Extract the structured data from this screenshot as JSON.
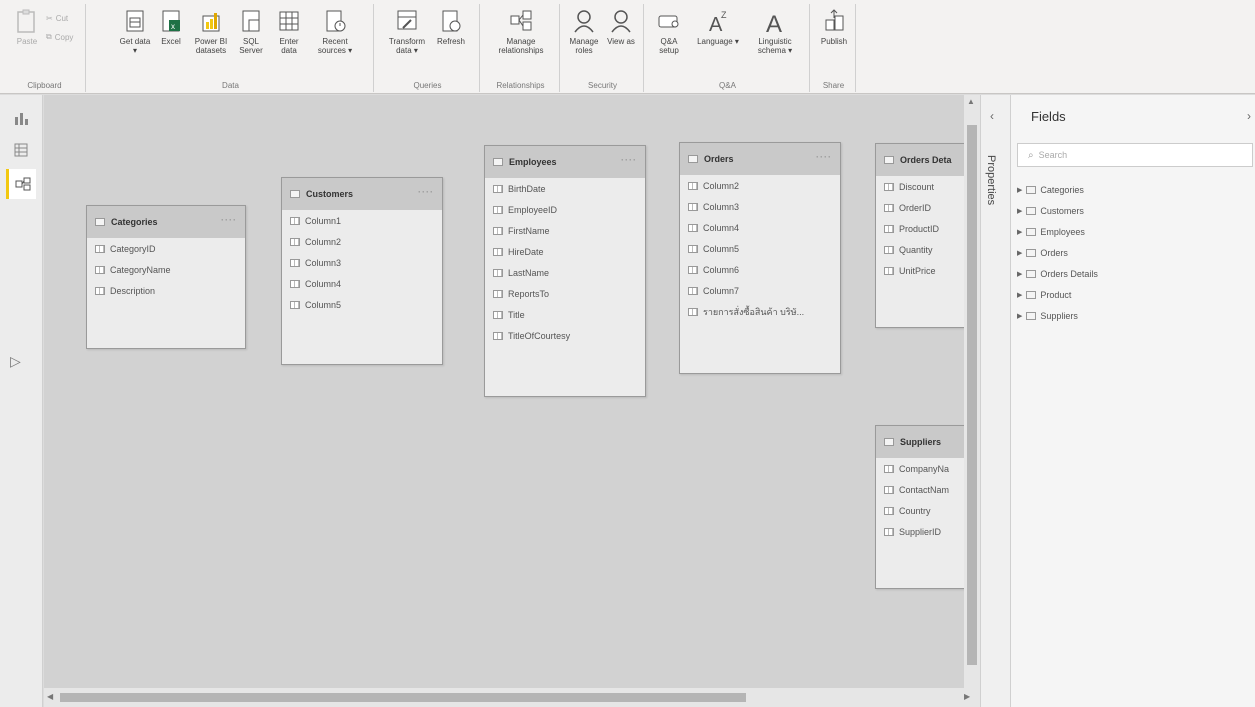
{
  "ribbon": {
    "clipboard": {
      "paste": "Paste",
      "cut": "Cut",
      "copy": "Copy",
      "label": "Clipboard"
    },
    "data": {
      "label": "Data",
      "buttons": [
        "Get data ▾",
        "Excel",
        "Power BI datasets",
        "SQL Server",
        "Enter data",
        "Recent sources ▾"
      ]
    },
    "queries": {
      "label": "Queries",
      "buttons": [
        "Transform data ▾",
        "Refresh"
      ]
    },
    "relationships": {
      "label": "Relationships",
      "buttons": [
        "Manage relationships"
      ]
    },
    "security": {
      "label": "Security",
      "buttons": [
        "Manage roles",
        "View as"
      ]
    },
    "qa": {
      "label": "Q&A",
      "buttons": [
        "Q&A setup",
        "Language ▾",
        "Linguistic schema ▾"
      ]
    },
    "share": {
      "label": "Share",
      "buttons": [
        "Publish"
      ]
    }
  },
  "tables": [
    {
      "name": "Categories",
      "fields": [
        "CategoryID",
        "CategoryName",
        "Description"
      ]
    },
    {
      "name": "Customers",
      "fields": [
        "Column1",
        "Column2",
        "Column3",
        "Column4",
        "Column5"
      ]
    },
    {
      "name": "Employees",
      "fields": [
        "BirthDate",
        "EmployeeID",
        "FirstName",
        "HireDate",
        "LastName",
        "ReportsTo",
        "Title",
        "TitleOfCourtesy"
      ]
    },
    {
      "name": "Orders",
      "fields": [
        "Column2",
        "Column3",
        "Column4",
        "Column5",
        "Column6",
        "Column7",
        "รายการสั่งซื้อสินค้า บริษั..."
      ]
    },
    {
      "name": "Orders Deta",
      "fields": [
        "Discount",
        "OrderID",
        "ProductID",
        "Quantity",
        "UnitPrice"
      ]
    },
    {
      "name": "Suppliers",
      "fields": [
        "CompanyNa",
        "ContactNam",
        "Country",
        "SupplierID"
      ]
    }
  ],
  "properties_label": "Properties",
  "fields_pane": {
    "title": "Fields",
    "search_placeholder": "Search",
    "items": [
      "Categories",
      "Customers",
      "Employees",
      "Orders",
      "Orders Details",
      "Product",
      "Suppliers"
    ]
  }
}
